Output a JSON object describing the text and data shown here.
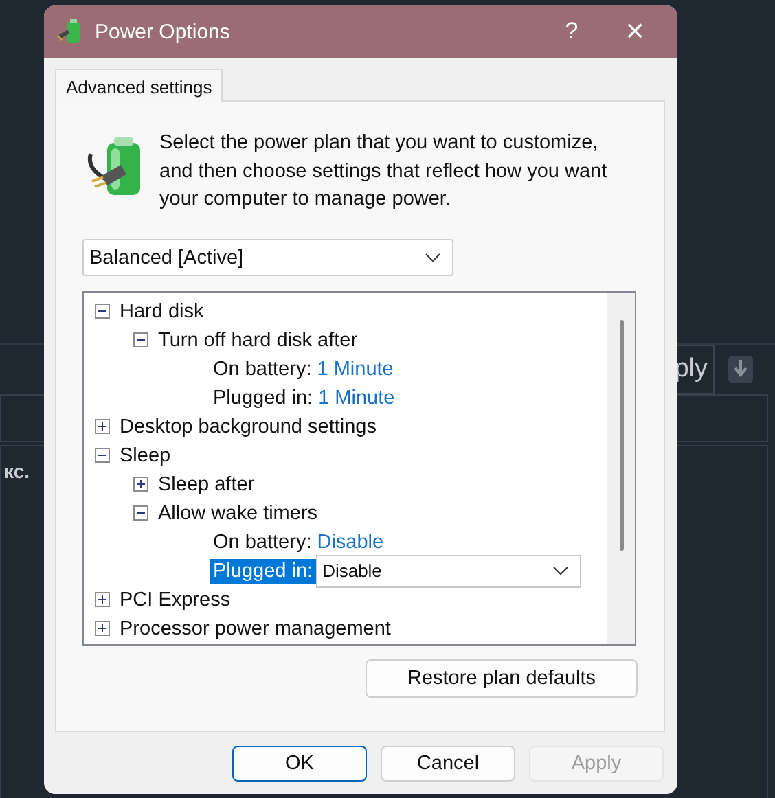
{
  "background": {
    "texts": [
      "кс.",
      "ply"
    ]
  },
  "window": {
    "title": "Power Options",
    "help": "?",
    "close": "✕"
  },
  "tabs": [
    {
      "label": "Advanced settings",
      "selected": true
    }
  ],
  "intro": "Select the power plan that you want to customize, and then choose settings that reflect how you want your computer to manage power.",
  "plan": {
    "value": "Balanced [Active]"
  },
  "tree": [
    {
      "kind": "group",
      "label": "Hard disk",
      "expanded": true,
      "children": [
        {
          "kind": "group",
          "label": "Turn off hard disk after",
          "expanded": true,
          "children": [
            {
              "kind": "setting",
              "label": "On battery:",
              "value": "1 Minute",
              "selected": false
            },
            {
              "kind": "setting",
              "label": "Plugged in:",
              "value": "1 Minute",
              "selected": false
            }
          ]
        }
      ]
    },
    {
      "kind": "group",
      "label": "Desktop background settings",
      "expanded": false
    },
    {
      "kind": "group",
      "label": "Sleep",
      "expanded": true,
      "children": [
        {
          "kind": "group",
          "label": "Sleep after",
          "expanded": false
        },
        {
          "kind": "group",
          "label": "Allow wake timers",
          "expanded": true,
          "children": [
            {
              "kind": "setting",
              "label": "On battery:",
              "value": "Disable",
              "selected": false
            },
            {
              "kind": "setting",
              "label": "Plugged in:",
              "value": "Disable",
              "selected": true
            }
          ]
        }
      ]
    },
    {
      "kind": "group",
      "label": "PCI Express",
      "expanded": false
    },
    {
      "kind": "group",
      "label": "Processor power management",
      "expanded": false
    }
  ],
  "restore_button": "Restore plan defaults",
  "buttons": [
    {
      "label": "OK",
      "kind": "default",
      "disabled": false
    },
    {
      "label": "Cancel",
      "kind": "normal",
      "disabled": false
    },
    {
      "label": "Apply",
      "kind": "normal",
      "disabled": true
    }
  ]
}
